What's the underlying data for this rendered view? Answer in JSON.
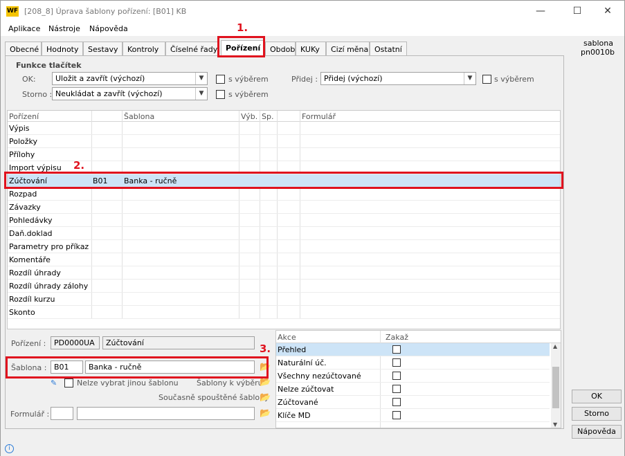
{
  "window": {
    "title": "[208_8] Úprava šablony pořízení: [B01] KB",
    "logo": "WF",
    "min": "—",
    "max": "☐",
    "close": "✕"
  },
  "menu": [
    "Aplikace",
    "Nástroje",
    "Nápověda"
  ],
  "side": {
    "line1": "sablona",
    "line2": "pn0010b"
  },
  "tabs": [
    "Obecné",
    "Hodnoty",
    "Sestavy",
    "Kontroly",
    "Číselné řady",
    "Pořízení",
    "Období",
    "KUKy",
    "Cizí měna",
    "Ostatní"
  ],
  "funkce": {
    "title": "Funkce tlačítek",
    "ok_label": "OK:",
    "ok_value": "Uložit a zavřít (výchozí)",
    "storno_label": "Storno :",
    "storno_value": "Neukládat a zavřít (výchozí)",
    "s_vyberem": "s výběrem",
    "pridej_label": "Přidej :",
    "pridej_value": "Přidej (výchozí)"
  },
  "grid": {
    "headers": [
      "Pořízení",
      "Šablona",
      "Výb.",
      "Sp.",
      "Formulář"
    ],
    "rows": [
      [
        "Výpis",
        "",
        ""
      ],
      [
        "Položky",
        "",
        ""
      ],
      [
        "Přílohy",
        "",
        ""
      ],
      [
        "Import výpisu",
        "",
        ""
      ],
      [
        "Zúčtování",
        "B01",
        "Banka - ručně"
      ],
      [
        "Rozpad",
        "",
        ""
      ],
      [
        "Závazky",
        "",
        ""
      ],
      [
        "Pohledávky",
        "",
        ""
      ],
      [
        "Daň.doklad",
        "",
        ""
      ],
      [
        "Parametry pro příkaz",
        "",
        ""
      ],
      [
        "Komentáře",
        "",
        ""
      ],
      [
        "Rozdíl úhrady",
        "",
        ""
      ],
      [
        "Rozdíl úhrady zálohy",
        "",
        ""
      ],
      [
        "Rozdíl kurzu",
        "",
        ""
      ],
      [
        "Skonto",
        "",
        ""
      ]
    ]
  },
  "detail": {
    "porizeni_label": "Pořízení :",
    "porizeni_code": "PD0000UA",
    "porizeni_name": "Zúčtování",
    "sablona_label": "Šablona :",
    "sablona_code": "B01",
    "sablona_name": "Banka - ručně",
    "nelze": "Nelze vybrat jinou šablonu",
    "sablony_k_vyberu": "Šablony k výběru",
    "soucasne": "Současně spouštěné šablony",
    "formular_label": "Formulář :"
  },
  "akce": {
    "headers": [
      "Akce",
      "Zakaž"
    ],
    "rows": [
      "Přehled",
      "Naturální úč.",
      "Všechny nezúčtované",
      "Nelze zúčtovat",
      "Zúčtované",
      "Klíče MD"
    ]
  },
  "buttons": {
    "ok": "OK",
    "storno": "Storno",
    "napoveda": "Nápověda"
  },
  "annotations": [
    "1.",
    "2.",
    "3."
  ],
  "colors": {
    "annotation": "#e0121e",
    "selection": "#cde4f7",
    "logo": "#f5c400"
  }
}
